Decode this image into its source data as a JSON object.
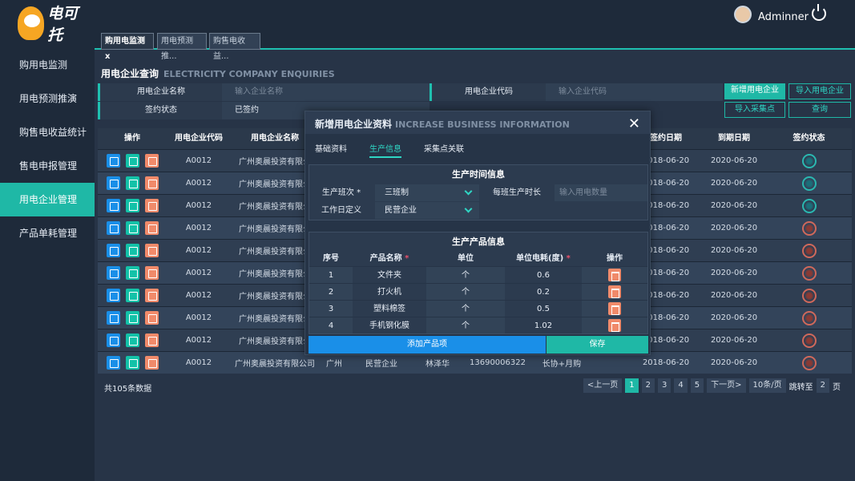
{
  "brand": {
    "name": "电可托"
  },
  "user": {
    "name": "Adminner"
  },
  "sidebar": {
    "items": [
      {
        "label": "购用电监测"
      },
      {
        "label": "用电预测推演"
      },
      {
        "label": "购售电收益统计"
      },
      {
        "label": "售电申报管理"
      },
      {
        "label": "用电企业管理"
      },
      {
        "label": "产品单耗管理"
      }
    ],
    "active_index": 4
  },
  "tabs": [
    {
      "label": "购用电监测 x"
    },
    {
      "label": "用电预测推..."
    },
    {
      "label": "购售电收益..."
    }
  ],
  "query": {
    "title": "用电企业查询",
    "title_en": "ELECTRICITY COMPANY ENQUIRIES",
    "name_label": "用电企业名称",
    "name_placeholder": "输入企业名称",
    "code_label": "用电企业代码",
    "code_placeholder": "输入企业代码",
    "status_label": "签约状态",
    "status_value": "已签约",
    "buttons": {
      "add": "新增用电企业",
      "import": "导入用电企业",
      "import_collect": "导入采集点",
      "search": "查询"
    }
  },
  "table": {
    "headers": [
      "操作",
      "用电企业代码",
      "用电企业名称",
      "签约日期",
      "到期日期",
      "签约状态"
    ],
    "rows": [
      {
        "code": "A0012",
        "name": "广州奥晨投资有限公",
        "sign": "2018-06-20",
        "expire": "2020-06-20",
        "status": "green"
      },
      {
        "code": "A0012",
        "name": "广州奥晨投资有限公",
        "sign": "2018-06-20",
        "expire": "2020-06-20",
        "status": "green"
      },
      {
        "code": "A0012",
        "name": "广州奥晨投资有限公",
        "sign": "2018-06-20",
        "expire": "2020-06-20",
        "status": "green"
      },
      {
        "code": "A0012",
        "name": "广州奥晨投资有限公",
        "sign": "2018-06-20",
        "expire": "2020-06-20",
        "status": "red"
      },
      {
        "code": "A0012",
        "name": "广州奥晨投资有限公",
        "sign": "2018-06-20",
        "expire": "2020-06-20",
        "status": "red"
      },
      {
        "code": "A0012",
        "name": "广州奥晨投资有限公",
        "sign": "2018-06-20",
        "expire": "2020-06-20",
        "status": "red"
      },
      {
        "code": "A0012",
        "name": "广州奥晨投资有限公",
        "sign": "2018-06-20",
        "expire": "2020-06-20",
        "status": "red"
      },
      {
        "code": "A0012",
        "name": "广州奥晨投资有限公",
        "sign": "2018-06-20",
        "expire": "2020-06-20",
        "status": "red"
      },
      {
        "code": "A0012",
        "name": "广州奥晨投资有限公",
        "sign": "2018-06-20",
        "expire": "2020-06-20",
        "status": "red"
      },
      {
        "code": "A0012",
        "name": "广州奥晨投资有限公司",
        "city": "广州",
        "type": "民营企业",
        "contact": "林泽华",
        "phone": "13690006322",
        "rep": "长协+月购",
        "sign": "2018-06-20",
        "expire": "2020-06-20",
        "status": "red"
      }
    ]
  },
  "footer": {
    "total": "共105条数据",
    "prev": "<上一页",
    "next": "下一页>",
    "pages": [
      "1",
      "2",
      "3",
      "4",
      "5"
    ],
    "per_page": "10条/页",
    "jump_label": "跳转至",
    "jump_value": "2",
    "jump_unit": "页"
  },
  "modal": {
    "title": "新增用电企业资料",
    "title_en": "INCREASE BUSINESS INFORMATION",
    "tabs": [
      "基础资料",
      "生产信息",
      "采集点关联"
    ],
    "active_tab": 1,
    "time_section": {
      "title": "生产时间信息",
      "shift_label": "生产班次 *",
      "shift_value": "三班制",
      "hours_label": "每班生产时长",
      "hours_placeholder": "输入用电数量",
      "workday_label": "工作日定义",
      "workday_value": "民营企业"
    },
    "product_section": {
      "title": "生产产品信息",
      "headers": [
        "序号",
        "产品名称",
        "单位",
        "单位电耗(度)",
        "操作"
      ],
      "rows": [
        {
          "no": "1",
          "name": "文件夹",
          "unit": "个",
          "value": "0.6"
        },
        {
          "no": "2",
          "name": "打火机",
          "unit": "个",
          "value": "0.2"
        },
        {
          "no": "3",
          "name": "塑料棉签",
          "unit": "个",
          "value": "0.5"
        },
        {
          "no": "4",
          "name": "手机钢化膜",
          "unit": "个",
          "value": "1.02"
        }
      ]
    },
    "buttons": {
      "add_product": "添加产品项",
      "save": "保存"
    }
  }
}
